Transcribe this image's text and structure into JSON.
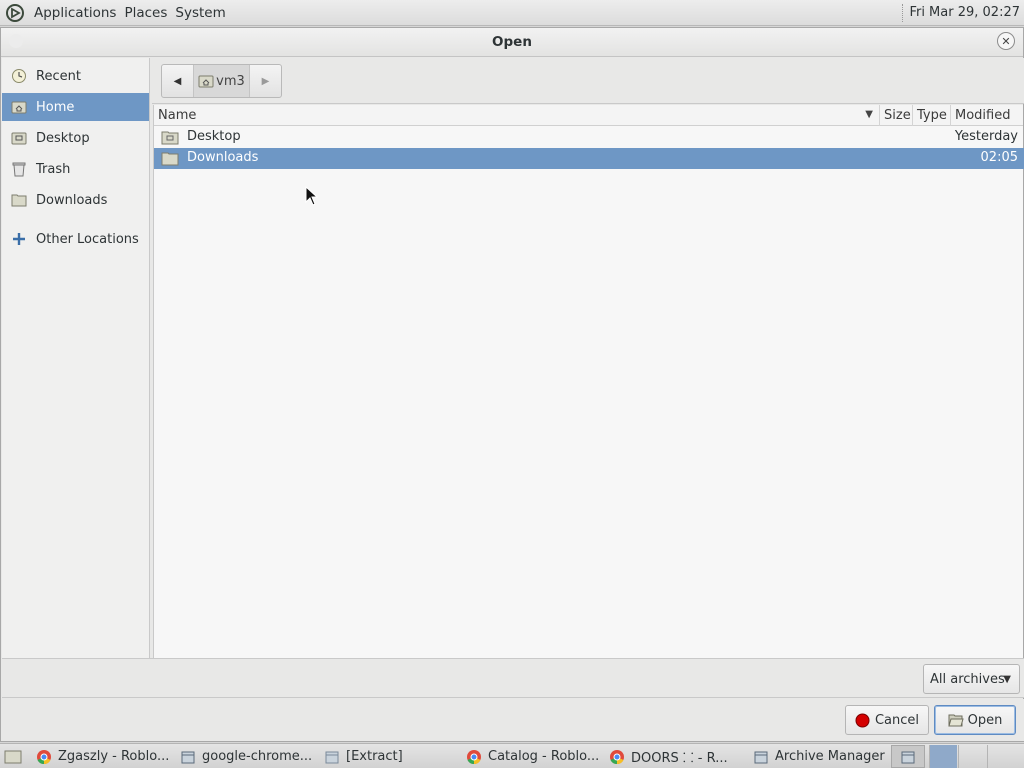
{
  "top_panel": {
    "menus": [
      "Applications",
      "Places",
      "System"
    ],
    "clock": "Fri Mar 29, 02:27"
  },
  "dialog": {
    "title": "Open",
    "sidebar": [
      {
        "label": "Recent",
        "icon": "clock-icon"
      },
      {
        "label": "Home",
        "icon": "home-folder-icon",
        "selected": true
      },
      {
        "label": "Desktop",
        "icon": "desktop-folder-icon"
      },
      {
        "label": "Trash",
        "icon": "trash-icon"
      },
      {
        "label": "Downloads",
        "icon": "folder-icon"
      },
      {
        "label": "Other Locations",
        "icon": "plus-icon"
      }
    ],
    "pathbar": {
      "crumb": "vm3"
    },
    "columns": {
      "name": "Name",
      "size": "Size",
      "type": "Type",
      "modified": "Modified"
    },
    "files": [
      {
        "name": "Desktop",
        "modified": "Yesterday",
        "selected": false
      },
      {
        "name": "Downloads",
        "modified": "02:05",
        "selected": true
      }
    ],
    "filter": "All archives",
    "buttons": {
      "cancel": "Cancel",
      "open": "Open"
    }
  },
  "taskbar": {
    "tasks": [
      "Zgaszly - Roblo...",
      "google-chrome...",
      "[Extract]",
      "Catalog - Roblo...",
      "DOORS ⸬ - R...",
      "Archive Manager"
    ]
  },
  "colors": {
    "selection": "#6e97c5",
    "accent_border": "#5f8bc2"
  }
}
